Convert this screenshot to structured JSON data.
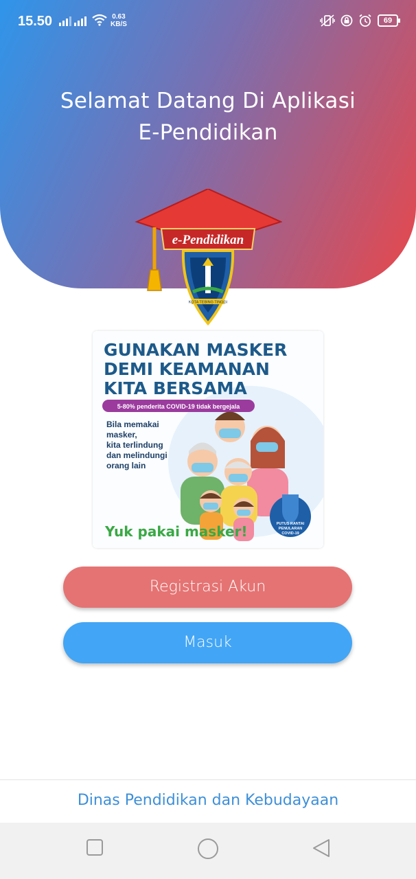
{
  "status_bar": {
    "time": "15.50",
    "speed_value": "0.63",
    "speed_unit": "KB/S",
    "battery": "69",
    "icons": [
      "signal-icon",
      "signal-icon",
      "wifi-icon",
      "vibrate-icon",
      "lock-rotation-icon",
      "alarm-icon",
      "battery-icon"
    ]
  },
  "header": {
    "welcome_line1": "Selamat Datang Di Aplikasi",
    "welcome_line2": "E-Pendidikan",
    "gradient_colors": [
      "#2f95ea",
      "#e9474a"
    ]
  },
  "logo": {
    "banner_text": "e-Pendidikan",
    "emblem_text": "KOTA TEBING TINGGI"
  },
  "promo_banner": {
    "headline1": "GUNAKAN MASKER",
    "headline2": "DEMI KEAMANAN",
    "headline3": "KITA BERSAMA",
    "pill": "5-80% penderita COVID-19 tidak bergejala",
    "body1": "Bila memakai",
    "body2": "masker,",
    "body3": "kita terlindung",
    "body4": "dan melindungi",
    "body5": "orang lain",
    "cta": "Yuk pakai masker!",
    "badge1": "PUTUS RANTAI",
    "badge2": "PENULARAN",
    "badge3": "COVID-19"
  },
  "buttons": {
    "register": "Registrasi Akun",
    "login": "Masuk",
    "register_color": "#e57373",
    "login_color": "#42a5f5"
  },
  "footer": {
    "text": "Dinas Pendidikan dan Kebudayaan"
  },
  "nav_bar": {
    "icons": [
      "recent-apps-icon",
      "home-icon",
      "back-icon"
    ]
  }
}
